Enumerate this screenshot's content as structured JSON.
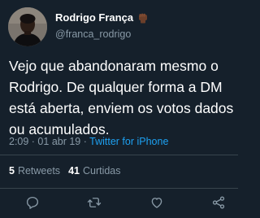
{
  "author": {
    "display_name": "Rodrigo França",
    "handle": "@franca_rodrigo",
    "badge_emoji": "raised-fist-icon"
  },
  "tweet": {
    "text": "Vejo que abandonaram mesmo o Rodrigo. De qualquer forma a DM está aberta, enviem os votos dados ou acumulados.",
    "time_date": "2:09 · 01 abr 19 · ",
    "source": "Twitter for iPhone"
  },
  "stats": {
    "retweets_count": "5",
    "retweets_label": "Retweets",
    "likes_count": "41",
    "likes_label": "Curtidas"
  },
  "actions": {
    "reply_icon": "reply-icon",
    "retweet_icon": "retweet-icon",
    "like_icon": "heart-icon",
    "share_icon": "share-icon"
  },
  "colors": {
    "background": "#15202b",
    "secondary_text": "#8899a6",
    "link": "#1da1f2",
    "divider": "#38444d"
  }
}
